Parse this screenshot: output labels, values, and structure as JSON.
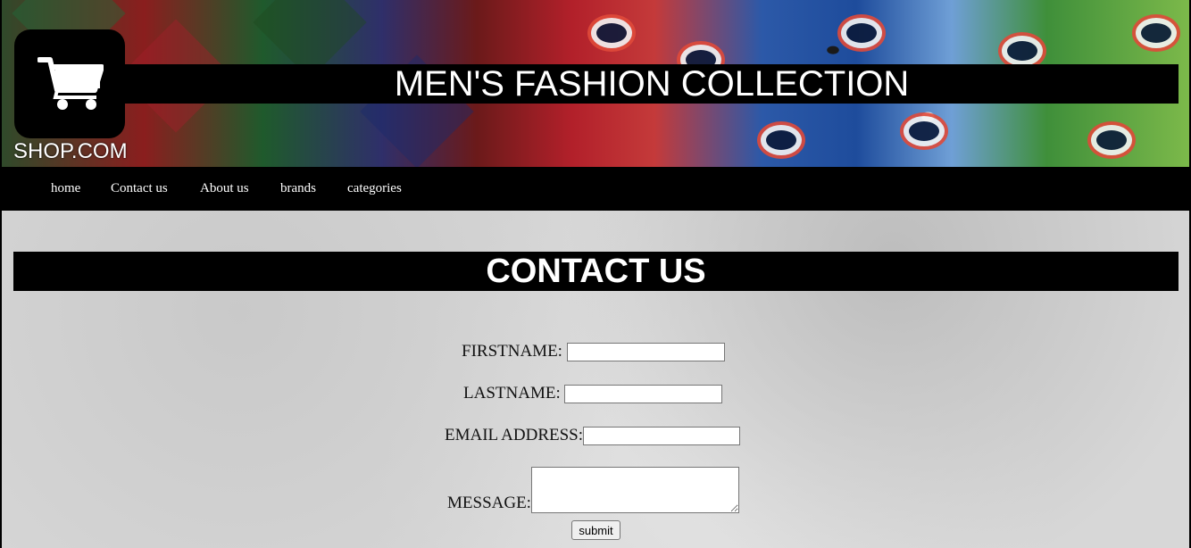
{
  "brand": {
    "logo_text": "SHOP.COM"
  },
  "header": {
    "title": "MEN'S FASHION COLLECTION"
  },
  "nav": {
    "items": [
      {
        "label": "home"
      },
      {
        "label": "Contact us"
      },
      {
        "label": "About us"
      },
      {
        "label": "brands"
      },
      {
        "label": "categories"
      }
    ]
  },
  "contact": {
    "heading": "CONTACT US",
    "fields": {
      "firstname": {
        "label": "FIRSTNAME:",
        "value": ""
      },
      "lastname": {
        "label": "LASTNAME:",
        "value": ""
      },
      "email": {
        "label": "EMAIL ADDRESS:",
        "value": ""
      },
      "message": {
        "label": "MESSAGE:",
        "value": ""
      }
    },
    "submit_label": "submit"
  },
  "colors": {
    "nav_bg": "#000000",
    "text_on_dark": "#ffffff",
    "page_bg": "#d6d6d6"
  },
  "icons": {
    "logo": "shopping-cart-icon"
  }
}
